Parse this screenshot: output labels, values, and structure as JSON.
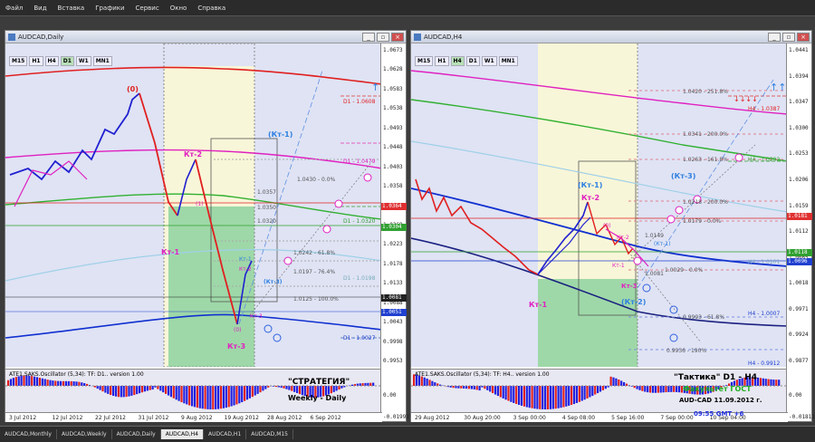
{
  "menu": [
    "Файл",
    "Вид",
    "Вставка",
    "Графики",
    "Сервис",
    "Окно",
    "Справка"
  ],
  "window_buttons": {
    "minimize": "_",
    "restore": "▫",
    "close": "×"
  },
  "timeframes": [
    "M15",
    "H1",
    "H4",
    "D1",
    "W1",
    "MN1"
  ],
  "left": {
    "title": "AUDCAD,Daily",
    "active_tf": "D1",
    "price_axis": [
      "1.0673",
      "1.0628",
      "1.0583",
      "1.0538",
      "1.0493",
      "1.0448",
      "1.0403",
      "1.0358",
      "1.0313",
      "1.0268",
      "1.0223",
      "1.0178",
      "1.0133",
      "1.0088",
      "1.0043",
      "0.9998",
      "0.9953"
    ],
    "price_badges": [
      {
        "text": "1.0364",
        "color": "#e03030"
      },
      {
        "text": "1.0304",
        "color": "#30a030"
      },
      {
        "text": "1.0081",
        "color": "#202020"
      },
      {
        "text": "1.0051",
        "color": "#2040d0"
      }
    ],
    "osc_axis": [
      "0.00",
      "-0.01993"
    ],
    "dates": [
      "3 Jul 2012",
      "12 Jul 2012",
      "22 Jul 2012",
      "31 Jul 2012",
      "9 Aug 2012",
      "19 Aug 2012",
      "28 Aug 2012",
      "6 Sep 2012"
    ],
    "labels": {
      "kt0": "(0)",
      "kt1": "Кт-1",
      "kt2": "Кт-2",
      "kt3": "Кт-3",
      "kt1_blue": "(Кт-1)",
      "kt3_blue": "(Кт-3)",
      "kt1_small": "Кт-1",
      "kt2_small": "Кт-2",
      "kt3_small": "Кт-3",
      "kt1_mini": "(1)",
      "kt0_mini": "(0)"
    },
    "levels": [
      "1.0430 - 0.0%",
      "1.0357",
      "1.0350",
      "1.0320",
      "1.0242 - 61.8%",
      "1.0197 - 76.4%",
      "1.0125 - 100.0%",
      "D1 - 1.0479",
      "D1 - 1.0320",
      "D1 - 1.0198",
      "D1 - 1.0027",
      "D1 - 1.0608"
    ],
    "osc_label": "ATE1.SAKS.Oscillator (5,34): TF: D1.. version 1.00",
    "note_title": "\"СТРАТЕГИЯ\"",
    "note_sub": "Weekly - Daily"
  },
  "right": {
    "title": "AUDCAD,H4",
    "active_tf": "H4",
    "price_axis": [
      "1.0441",
      "1.0394",
      "1.0347",
      "1.0300",
      "1.0253",
      "1.0206",
      "1.0159",
      "1.0112",
      "1.0065",
      "1.0018",
      "0.9971",
      "0.9924",
      "0.9877"
    ],
    "price_badges": [
      {
        "text": "1.0181",
        "color": "#e03030"
      },
      {
        "text": "1.0118",
        "color": "#30a030"
      },
      {
        "text": "1.0096",
        "color": "#2040d0"
      }
    ],
    "osc_axis": [
      "0.00",
      "-0.01811"
    ],
    "dates": [
      "29 Aug 2012",
      "30 Aug 20:00",
      "3 Sep 00:00",
      "4 Sep 08:00",
      "5 Sep 16:00",
      "7 Sep 00:00",
      "10 Sep 04:00"
    ],
    "labels": {
      "kt1": "Кт-1",
      "kt2": "Кт-2",
      "kt3": "Кт-3",
      "kt1_blue": "(Кт-1)",
      "kt2_blue": "(Кт-2)",
      "kt3_blue": "(Кт-3)",
      "kt2_small": "Кт-2",
      "kt0": "(0)",
      "kt1_tiny": "Кт-1",
      "kt1_b2": "(Кт-1)"
    },
    "levels": [
      "1.0420 - 251.8%",
      "1.0341 - 200.0%",
      "1.0263 - 161.8%",
      "1.0218 - 200.0%",
      "1.0179 - 0.0%",
      "1.0149",
      "1.0081",
      "1.0029 - 0.0%",
      "0.9993 - 61.8%",
      "0.9936 - 190%",
      "H4 - 1.0387",
      "H4 - 1.0292",
      "H4 - 1.0101",
      "H4 - 1.0007",
      "H4 - 0.9912"
    ],
    "osc_label": "ATE1.SAKS.Oscillator (5,34): TF: H4.. version 1.00",
    "note_title": "\"Тактика\"  D1 - H4",
    "note_sub": "Факультет ГОСТ",
    "note_pair": "AUD-CAD 11.09.2012  г.",
    "note_time": "09:55   GMT +6"
  },
  "tabs": [
    "AUDCAD,Monthly",
    "AUDCAD,Weekly",
    "AUDCAD,Daily",
    "AUDCAD,H4",
    "AUDCAD,H1",
    "AUDCAD,M15"
  ],
  "active_tab": "AUDCAD,H4",
  "colors": {
    "bull": "#2020e0",
    "bear": "#e02020",
    "magenta": "#e020c0",
    "ma_green": "#30b030",
    "ma_red": "#e02020",
    "note_green": "#20b020",
    "note_blue": "#2030e0"
  }
}
